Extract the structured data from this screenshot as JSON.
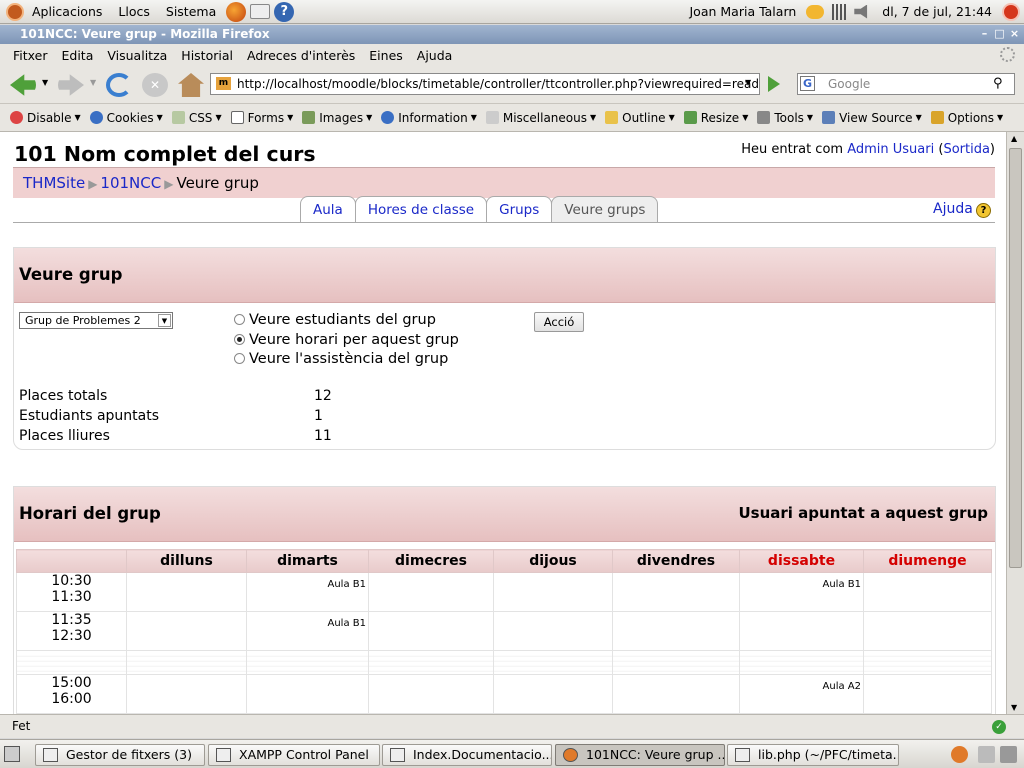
{
  "top_panel": {
    "menus": [
      "Aplicacions",
      "Llocs",
      "Sistema"
    ],
    "user": "Joan Maria Talarn",
    "clock": "dl,  7 de jul, 21:44"
  },
  "window": {
    "title": "101NCC: Veure grup - Mozilla Firefox"
  },
  "menubar": [
    "Fitxer",
    "Edita",
    "Visualitza",
    "Historial",
    "Adreces d'interès",
    "Eines",
    "Ajuda"
  ],
  "navbar": {
    "url": "http://localhost/moodle/blocks/timetable/controller/ttcontroller.php?viewrequired=readgr",
    "search_placeholder": "Google"
  },
  "devbar": [
    "Disable",
    "Cookies",
    "CSS",
    "Forms",
    "Images",
    "Information",
    "Miscellaneous",
    "Outline",
    "Resize",
    "Tools",
    "View Source",
    "Options"
  ],
  "page": {
    "course_title": "101 Nom complet del curs",
    "login_prefix": "Heu entrat com ",
    "login_user": "Admin Usuari",
    "logout": "Sortida",
    "breadcrumb": [
      "THMSite",
      "101NCC",
      "Veure grup"
    ],
    "tabs": [
      "Aula",
      "Hores de classe",
      "Grups",
      "Veure grups"
    ],
    "help": "Ajuda",
    "group_box": {
      "title": "Veure grup",
      "selected_group": "Grup de Problemes 2",
      "radios": [
        "Veure estudiants del grup",
        "Veure horari per aquest grup",
        "Veure l'assistència del grup"
      ],
      "selected_radio": 1,
      "action_button": "Acció",
      "stats": [
        {
          "label": "Places totals",
          "value": "12"
        },
        {
          "label": "Estudiants apuntats",
          "value": "1"
        },
        {
          "label": "Places lliures",
          "value": "11"
        }
      ]
    },
    "schedule_box": {
      "title": "Horari del grup",
      "subtitle": "Usuari apuntat a aquest grup",
      "days": [
        "dilluns",
        "dimarts",
        "dimecres",
        "dijous",
        "divendres",
        "dissabte",
        "diumenge"
      ],
      "rows": [
        {
          "start": "10:30",
          "end": "11:30",
          "cells": [
            "",
            "Aula B1",
            "",
            "",
            "",
            "Aula B1",
            ""
          ]
        },
        {
          "start": "11:35",
          "end": "12:30",
          "cells": [
            "",
            "Aula B1",
            "",
            "",
            "",
            "",
            ""
          ]
        },
        {
          "start": "15:00",
          "end": "16:00",
          "cells": [
            "",
            "",
            "",
            "",
            "",
            "Aula A2",
            ""
          ]
        }
      ]
    }
  },
  "status": "Fet",
  "taskbar": [
    "Gestor de fitxers (3)",
    "XAMPP Control Panel",
    "Index.Documentacio....",
    "101NCC: Veure grup ...",
    "lib.php (~/PFC/timeta..."
  ],
  "colors": {
    "accent_bg": "#f0d0d0",
    "link": "#1a28c8",
    "weekend": "#d40000"
  }
}
